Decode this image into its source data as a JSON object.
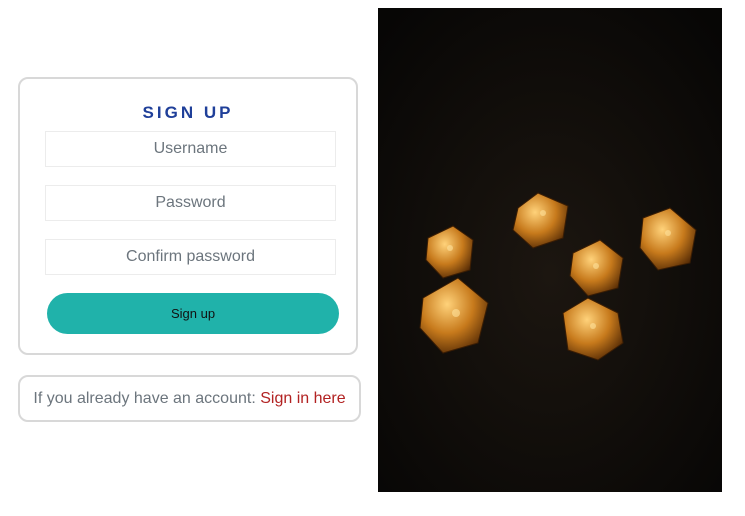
{
  "signup": {
    "title": "SIGN UP",
    "username_placeholder": "Username",
    "password_placeholder": "Password",
    "confirm_placeholder": "Confirm password",
    "button_label": "Sign up"
  },
  "signin_prompt": {
    "text": "If you already have an account:",
    "link_label": "Sign in here"
  },
  "colors": {
    "title": "#1f3f99",
    "button": "#20b2aa",
    "link": "#b22222",
    "muted_text": "#6c757d"
  },
  "image": {
    "subject": "golden dice"
  }
}
